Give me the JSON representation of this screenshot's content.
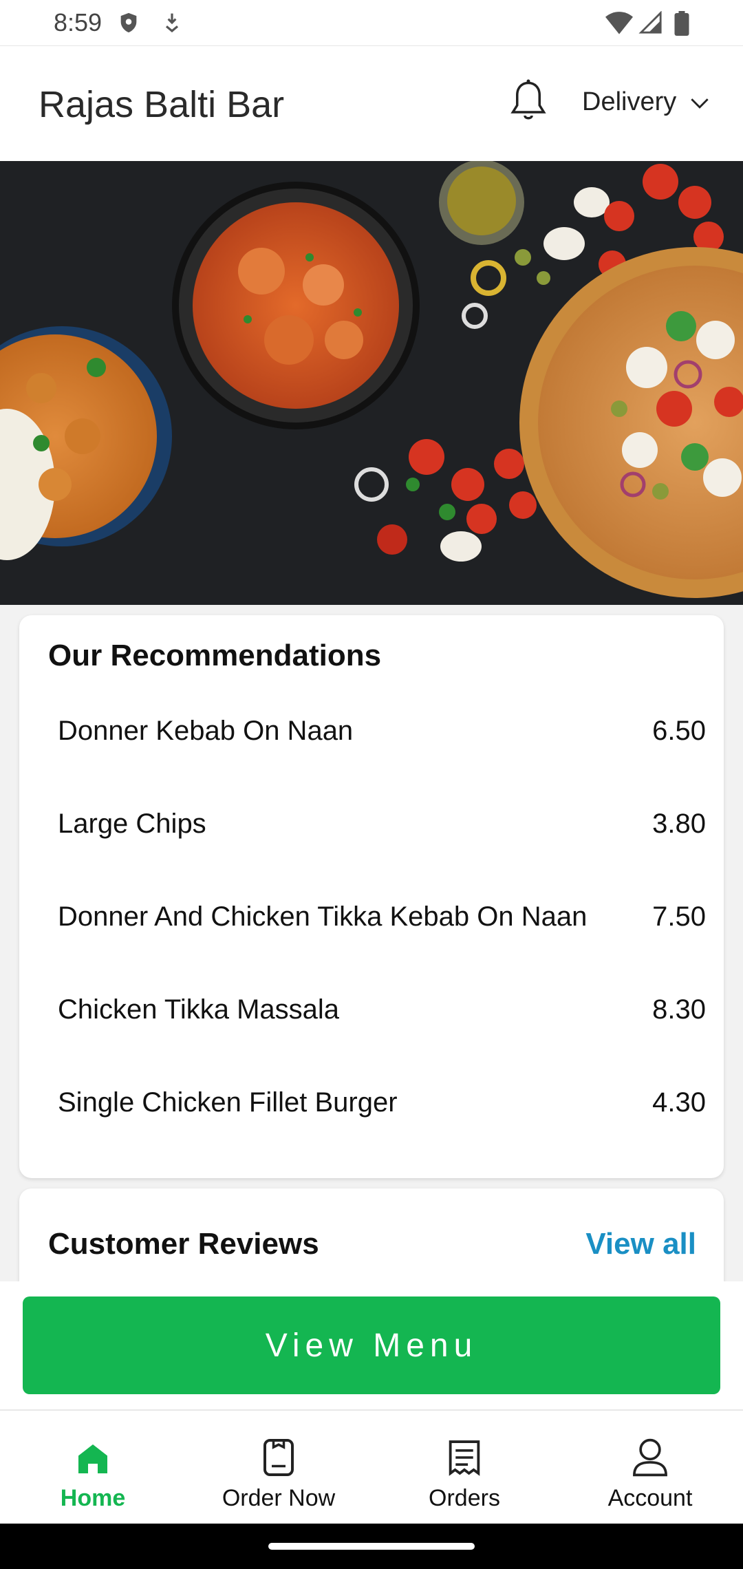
{
  "status_bar": {
    "time": "8:59",
    "icons": [
      "shield-icon",
      "download-icon",
      "wifi-icon",
      "signal-icon",
      "battery-icon"
    ]
  },
  "header": {
    "title": "Rajas Balti Bar",
    "notification_icon": "bell-icon",
    "order_type": "Delivery",
    "order_type_icon": "chevron-down-icon"
  },
  "hero": {
    "image": "food-banner"
  },
  "recommendations": {
    "title": "Our Recommendations",
    "items": [
      {
        "name": "Donner Kebab On Naan",
        "price": "6.50"
      },
      {
        "name": "Large Chips",
        "price": "3.80"
      },
      {
        "name": "Donner And Chicken Tikka Kebab On Naan",
        "price": "7.50"
      },
      {
        "name": "Chicken Tikka Massala",
        "price": "8.30"
      },
      {
        "name": "Single Chicken Fillet Burger",
        "price": "4.30"
      }
    ]
  },
  "reviews": {
    "title": "Customer Reviews",
    "view_all": "View all"
  },
  "cta": {
    "label": "View Menu",
    "color": "#14b651"
  },
  "bottom_nav": {
    "items": [
      {
        "label": "Home",
        "icon": "home-icon",
        "active": true
      },
      {
        "label": "Order Now",
        "icon": "order-icon",
        "active": false
      },
      {
        "label": "Orders",
        "icon": "receipt-icon",
        "active": false
      },
      {
        "label": "Account",
        "icon": "user-icon",
        "active": false
      }
    ]
  },
  "colors": {
    "accent_green": "#14b651",
    "link_blue": "#1a8fc4"
  }
}
